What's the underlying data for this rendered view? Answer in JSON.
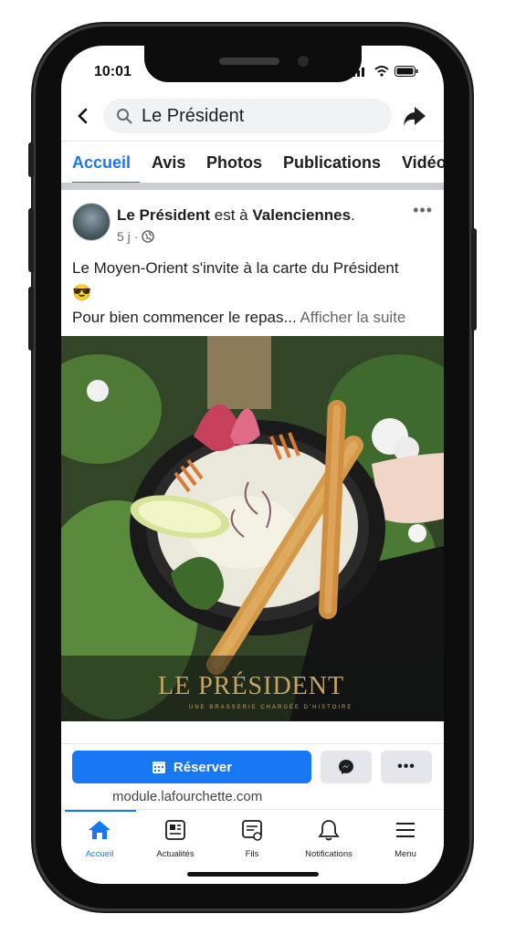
{
  "status_bar": {
    "time": "10:01"
  },
  "header": {
    "search_value": "Le Président"
  },
  "tabs": [
    {
      "label": "Accueil"
    },
    {
      "label": "Avis"
    },
    {
      "label": "Photos"
    },
    {
      "label": "Publications"
    },
    {
      "label": "Vidéo"
    }
  ],
  "post": {
    "author": "Le Président",
    "connector": " est à ",
    "location": "Valenciennes",
    "location_suffix": ".",
    "time": "5 j",
    "separator": "·",
    "text_line1": "Le Moyen-Orient s'invite à la carte du Président",
    "emoji": "😎",
    "text_line2": "Pour bien commencer le repas...",
    "see_more": "Afficher la suite",
    "image_logo": "LE PRÉSIDENT",
    "image_tagline": "UNE BRASSERIE CHARGÉE D'HISTOIRE"
  },
  "actions": {
    "reserve_label": "Réserver",
    "link": "module.lafourchette.com"
  },
  "bottom_nav": [
    {
      "label": "Accueil",
      "icon": "home-icon"
    },
    {
      "label": "Actualités",
      "icon": "news-icon"
    },
    {
      "label": "Fils",
      "icon": "feeds-icon"
    },
    {
      "label": "Notifications",
      "icon": "bell-icon"
    },
    {
      "label": "Menu",
      "icon": "menu-icon"
    }
  ],
  "colors": {
    "accent": "#1877f2",
    "text": "#1c1e21",
    "secondary": "#65676b"
  }
}
